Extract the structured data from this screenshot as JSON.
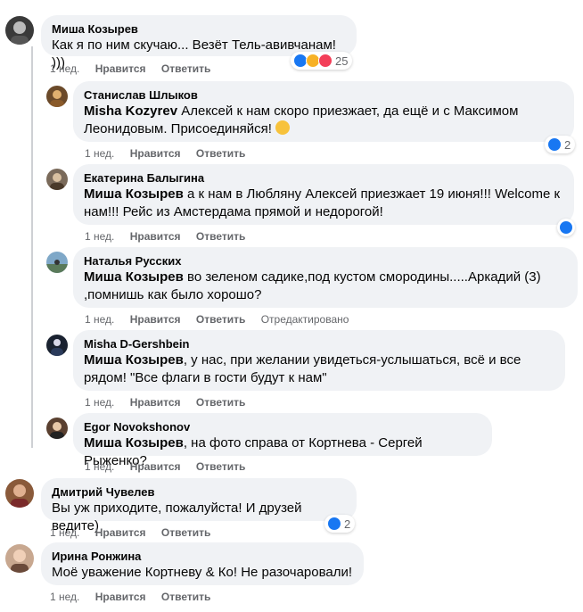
{
  "actions": {
    "like": "Нравится",
    "reply": "Ответить"
  },
  "comments": [
    {
      "author": "Миша Козырев",
      "mention": "",
      "text": "Как я по ним скучаю... Везёт Тель-авивчанам! )))",
      "time": "1 нед.",
      "reactions": "25"
    },
    {
      "author": "Станислав Шлыков",
      "mention": "Misha Kozyrev",
      "text": "Алексей к нам скоро приезжает, да ещё и с Максимом Леонидовым. Присоединяйся!",
      "time": "1 нед.",
      "reactions": "2"
    },
    {
      "author": "Екатерина Балыгина",
      "mention": "Миша Козырев",
      "text": "а к нам в Любляну Алексей приезжает 19 июня!!! Welcome к нам!!! Рейс из Амстердама прямой и недорогой!",
      "time": "1 нед.",
      "reactions": ""
    },
    {
      "author": "Наталья Русских",
      "mention": "Миша Козырев",
      "text": "во зеленом садике,под кустом смородины.....Аркадий (3) ,помнишь как было хорошо?",
      "time": "1 нед.",
      "edited": "Отредактировано"
    },
    {
      "author": "Misha D-Gershbein",
      "mention": "Миша Козырев",
      "text": ", у нас, при желании увидеться-услышаться, всё и все рядом! \"Все флаги в гости будут к нам\"",
      "time": "1 нед."
    },
    {
      "author": "Egor Novokshonov",
      "mention": "Миша Козырев",
      "text": ", на фото справа от Кортнева - Сергей Рыженко?",
      "time": "1 нед."
    },
    {
      "author": "Дмитрий Чувелев",
      "mention": "",
      "text": "Вы уж приходите, пожалуйста! И друзей ведите)",
      "time": "1 нед.",
      "reactions": "2"
    },
    {
      "author": "Ирина Ронжина",
      "mention": "",
      "text": "Моё уважение Кортневу & Ко! Не разочаровали!",
      "time": "1 нед."
    }
  ],
  "colors": {
    "like_blue": "#1877f2",
    "love_red": "#f33e58",
    "care_yellow": "#f7b125",
    "bubble_bg": "#f0f2f5",
    "meta_gray": "#65676b"
  }
}
